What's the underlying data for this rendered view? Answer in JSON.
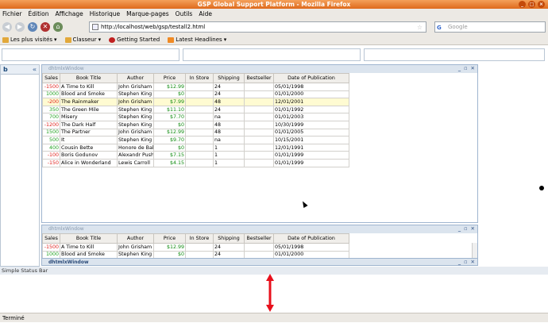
{
  "window": {
    "title": "GSP Global Support Platform - Mozilla Firefox"
  },
  "menu": [
    "Fichier",
    "Édition",
    "Affichage",
    "Historique",
    "Marque-pages",
    "Outils",
    "Aide"
  ],
  "nav": {
    "url": "http://localhost/web/gsp/testall2.html",
    "search_placeholder": "Google"
  },
  "bookmarks": [
    {
      "label": "Les plus visités",
      "icon": "folder-icon"
    },
    {
      "label": "Classeur",
      "icon": "folder-icon"
    },
    {
      "label": "Getting Started",
      "icon": "getting-started-icon"
    },
    {
      "label": "Latest Headlines",
      "icon": "rss-icon"
    }
  ],
  "left_pane": {
    "title": "b",
    "collapse": "«"
  },
  "window1": {
    "title": "dhtmlxWindow"
  },
  "window2": {
    "title": "dhtmlxWindow"
  },
  "window3": {
    "title": "dhtmlxWindow"
  },
  "grid": {
    "columns": [
      "Sales",
      "Book Title",
      "Author",
      "Price",
      "In Store",
      "Shipping",
      "Bestseller",
      "Date of Publication"
    ],
    "rows": [
      {
        "sales": "-1500",
        "title": "A Time to Kill",
        "author": "John Grisham",
        "price": "$12.99",
        "store": "",
        "shipping": "24",
        "best": "",
        "date": "05/01/1998"
      },
      {
        "sales": "1000",
        "title": "Blood and Smoke",
        "author": "Stephen King",
        "price": "$0",
        "store": "",
        "shipping": "24",
        "best": "",
        "date": "01/01/2000"
      },
      {
        "sales": "-200",
        "title": "The Rainmaker",
        "author": "John Grisham",
        "price": "$7.99",
        "store": "",
        "shipping": "48",
        "best": "",
        "date": "12/01/2001"
      },
      {
        "sales": "350",
        "title": "The Green Mile",
        "author": "Stephen King",
        "price": "$11.10",
        "store": "",
        "shipping": "24",
        "best": "",
        "date": "01/01/1992"
      },
      {
        "sales": "700",
        "title": "Misery",
        "author": "Stephen King",
        "price": "$7.70",
        "store": "",
        "shipping": "na",
        "best": "",
        "date": "01/01/2003"
      },
      {
        "sales": "-1200",
        "title": "The Dark Half",
        "author": "Stephen King",
        "price": "$0",
        "store": "",
        "shipping": "48",
        "best": "",
        "date": "10/30/1999"
      },
      {
        "sales": "1500",
        "title": "The Partner",
        "author": "John Grisham",
        "price": "$12.99",
        "store": "",
        "shipping": "48",
        "best": "",
        "date": "01/01/2005"
      },
      {
        "sales": "500",
        "title": "It",
        "author": "Stephen King",
        "price": "$9.70",
        "store": "",
        "shipping": "na",
        "best": "",
        "date": "10/15/2001"
      },
      {
        "sales": "400",
        "title": "Cousin Bette",
        "author": "Honore de Balzac",
        "price": "$0",
        "store": "",
        "shipping": "1",
        "best": "",
        "date": "12/01/1991"
      },
      {
        "sales": "-100",
        "title": "Boris Godunov",
        "author": "Alexandr Pushkin",
        "price": "$7.15",
        "store": "",
        "shipping": "1",
        "best": "",
        "date": "01/01/1999"
      },
      {
        "sales": "-150",
        "title": "Alice in Wonderland",
        "author": "Lewis Carroll",
        "price": "$4.15",
        "store": "",
        "shipping": "1",
        "best": "",
        "date": "01/01/1999"
      }
    ],
    "selected_index": 2
  },
  "grid2_rows": [
    {
      "sales": "-1500",
      "title": "A Time to Kill",
      "author": "John Grisham",
      "price": "$12.99",
      "store": "",
      "shipping": "24",
      "best": "",
      "date": "05/01/1998"
    },
    {
      "sales": "1000",
      "title": "Blood and Smoke",
      "author": "Stephen King",
      "price": "$0",
      "store": "",
      "shipping": "24",
      "best": "",
      "date": "01/01/2000"
    }
  ],
  "status_strip": "Simple Status Bar",
  "statusbar": "Terminé",
  "colors": {
    "title_bar": "#de6a1c",
    "neg_sales": "#e0201c",
    "pos_sales": "#1ea01e",
    "selected_row": "#fffbd2",
    "arrow": "#e8101c"
  }
}
